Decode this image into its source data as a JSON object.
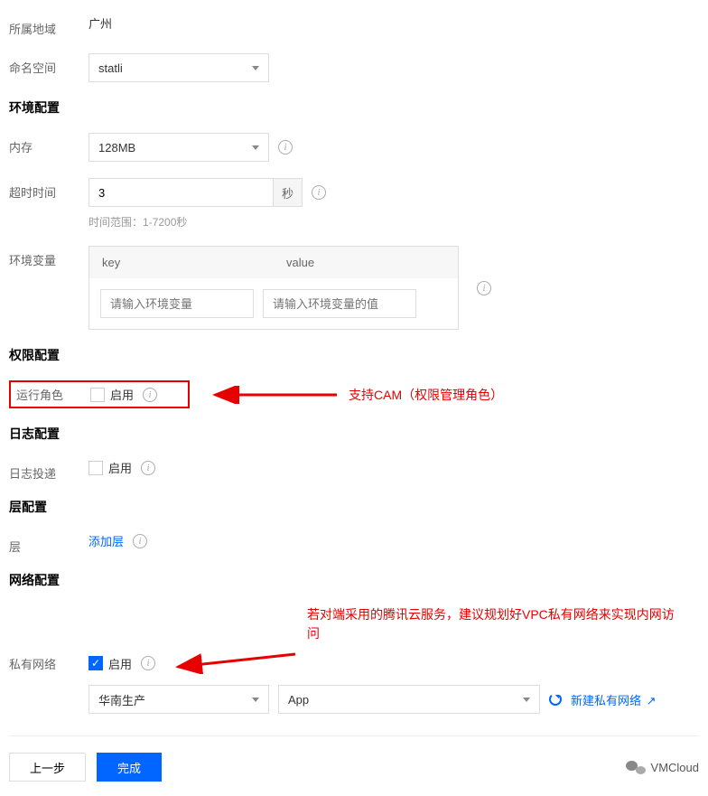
{
  "region": {
    "label": "所属地域",
    "value": "广州"
  },
  "namespace": {
    "label": "命名空间",
    "value": "statli"
  },
  "sections": {
    "env": "环境配置",
    "perm": "权限配置",
    "log": "日志配置",
    "layer": "层配置",
    "net": "网络配置"
  },
  "memory": {
    "label": "内存",
    "value": "128MB"
  },
  "timeout": {
    "label": "超时时间",
    "value": "3",
    "unit": "秒",
    "hint": "时间范围：1-7200秒"
  },
  "envvars": {
    "label": "环境变量",
    "key_header": "key",
    "value_header": "value",
    "key_placeholder": "请输入环境变量",
    "value_placeholder": "请输入环境变量的值"
  },
  "role": {
    "label": "运行角色",
    "enable": "启用"
  },
  "log": {
    "label": "日志投递",
    "enable": "启用"
  },
  "layer": {
    "label": "层",
    "link": "添加层"
  },
  "vpc": {
    "label": "私有网络",
    "enable": "启用",
    "select1": "华南生产",
    "select2": "App",
    "new_link": "新建私有网络"
  },
  "buttons": {
    "prev": "上一步",
    "done": "完成"
  },
  "brand": "VMCloud",
  "annotations": {
    "cam": "支持CAM（权限管理角色）",
    "vpc": "若对端采用的腾讯云服务，建议规划好VPC私有网络来实现内网访问"
  }
}
